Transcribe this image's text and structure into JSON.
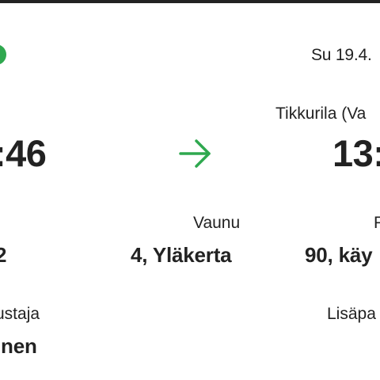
{
  "colors": {
    "accent_green": "#2fa84f",
    "text": "#222222",
    "background": "#ffffff"
  },
  "trip": {
    "date": "Su 19.4.",
    "arrival_station": "Tikkurila (Va",
    "departure_time": ":46",
    "arrival_time": "13:",
    "arrow_icon": "arrow-right-icon"
  },
  "details": {
    "seat_left_value": "2",
    "vaunu_label": "Vaunu",
    "vaunu_value": "4, Yläkerta",
    "paikka_label": "P",
    "paikka_value": "90, käy"
  },
  "passenger": {
    "label": "ustaja",
    "name": "inen",
    "extras_label": "Lisäpa"
  }
}
